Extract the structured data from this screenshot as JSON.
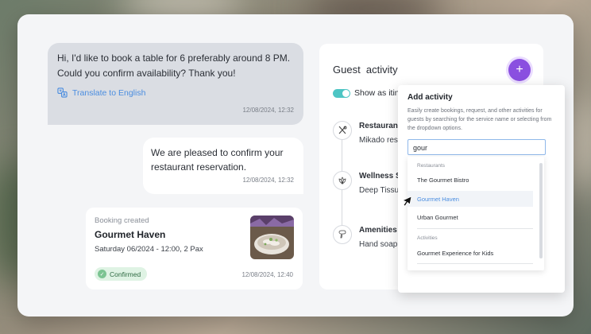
{
  "conversation": {
    "incoming": {
      "text": "Hi, I'd like to book a table for 6 preferably around 8 PM. Could you confirm availability? Thank you!",
      "translate_label": "Translate to English",
      "timestamp": "12/08/2024, 12:32"
    },
    "outgoing": {
      "text": "We are pleased to confirm your restaurant reservation.",
      "timestamp": "12/08/2024, 12:32"
    },
    "booking": {
      "caption": "Booking created",
      "name": "Gourmet Haven",
      "details": "Saturday 06/2024 - 12:00, 2 Pax",
      "status": "Confirmed",
      "timestamp": "12/08/2024, 12:40"
    }
  },
  "guest_activity": {
    "title": "Guest  activity",
    "add_icon": "plus-icon",
    "toggle_label": "Show as itin",
    "toggle_on": true,
    "items": [
      {
        "category": "Restaurant",
        "subtitle": "Mikado res",
        "icon": "cutlery-icon"
      },
      {
        "category": "Wellness S",
        "subtitle": "Deep Tissu",
        "icon": "lotus-icon"
      },
      {
        "category": "Amenities",
        "subtitle": "Hand soap",
        "icon": "hair-dryer-icon"
      }
    ]
  },
  "add_activity": {
    "title": "Add activity",
    "description": "Easily create bookings, request, and other activities for guests by searching for the service name or selecting from the dropdown options.",
    "search_value": "gour",
    "dropdown": {
      "sections": [
        {
          "label": "Restaurants",
          "items": [
            "The Gourmet Bistro",
            "Gourmet Haven",
            "Urban Gourmet"
          ]
        },
        {
          "label": "Activities",
          "items": [
            "Gourmet Experience for Kids"
          ]
        }
      ],
      "highlighted": "Gourmet Haven"
    }
  },
  "colors": {
    "accent_purple": "#8a4fe0",
    "link_blue": "#4a8de0",
    "toggle_teal": "#4ec5c4",
    "confirmed_green": "#7cc492"
  }
}
